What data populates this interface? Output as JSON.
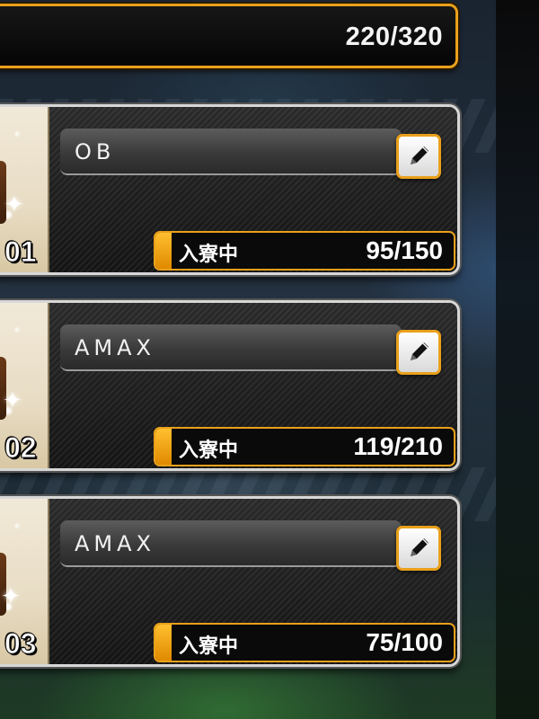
{
  "capacity": {
    "text": "220/320",
    "current": 220,
    "max": 320
  },
  "theme": {
    "accent": "#e9a01b",
    "card_border": "#d7d7d7"
  },
  "slots": [
    {
      "number": "01",
      "name": "OB",
      "status_label": "入寮中",
      "count_text": "95/150",
      "count": 95,
      "count_max": 150,
      "edit_icon": "pencil-icon"
    },
    {
      "number": "02",
      "name": "AMAX",
      "status_label": "入寮中",
      "count_text": "119/210",
      "count": 119,
      "count_max": 210,
      "edit_icon": "pencil-icon"
    },
    {
      "number": "03",
      "name": "AMAX",
      "status_label": "入寮中",
      "count_text": "75/100",
      "count": 75,
      "count_max": 100,
      "edit_icon": "pencil-icon"
    }
  ]
}
